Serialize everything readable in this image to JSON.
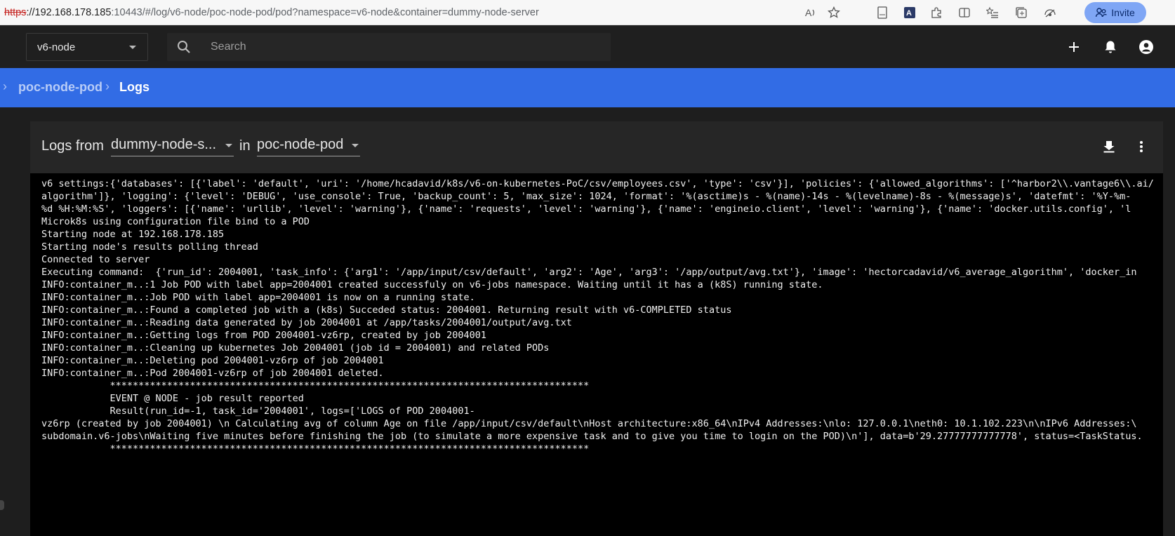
{
  "browser": {
    "url_scheme": "https",
    "url_host": "://192.168.178.185",
    "url_rest": ":10443/#/log/v6-node/poc-node-pod/pod?namespace=v6-node&container=dummy-node-server",
    "invite_label": "Invite"
  },
  "header": {
    "namespace": "v6-node",
    "search_placeholder": "Search"
  },
  "breadcrumb": {
    "parent": "poc-node-pod",
    "current": "Logs"
  },
  "logs": {
    "logs_from_label": "Logs from",
    "container_value": "dummy-node-s...",
    "in_label": "in",
    "pod_value": "poc-node-pod",
    "lines": [
      "v6 settings:{'databases': [{'label': 'default', 'uri': '/home/hcadavid/k8s/v6-on-kubernetes-PoC/csv/employees.csv', 'type': 'csv'}], 'policies': {'allowed_algorithms': ['^harbor2\\\\.vantage6\\\\.ai/",
      "algorithm']}, 'logging': {'level': 'DEBUG', 'use_console': True, 'backup_count': 5, 'max_size': 1024, 'format': '%(asctime)s - %(name)-14s - %(levelname)-8s - %(message)s', 'datefmt': '%Y-%m-",
      "%d %H:%M:%S', 'loggers': [{'name': 'urllib', 'level': 'warning'}, {'name': 'requests', 'level': 'warning'}, {'name': 'engineio.client', 'level': 'warning'}, {'name': 'docker.utils.config', 'l",
      "Microk8s using configuration file bind to a POD",
      "Starting node at 192.168.178.185",
      "Starting node's results polling thread",
      "Connected to server",
      "Executing command:  {'run_id': 2004001, 'task_info': {'arg1': '/app/input/csv/default', 'arg2': 'Age', 'arg3': '/app/output/avg.txt'}, 'image': 'hectorcadavid/v6_average_algorithm', 'docker_in",
      "INFO:container_m..:1 Job POD with label app=2004001 created successfuly on v6-jobs namespace. Waiting until it has a (k8S) running state.",
      "INFO:container_m..:Job POD with label app=2004001 is now on a running state.",
      "INFO:container_m..:Found a completed job with a (k8s) Succeded status: 2004001. Returning result with v6-COMPLETED status",
      "INFO:container_m..:Reading data generated by job 2004001 at /app/tasks/2004001/output/avg.txt",
      "INFO:container_m..:Getting logs from POD 2004001-vz6rp, created by job 2004001",
      "INFO:container_m..:Cleaning up kubernetes Job 2004001 (job id = 2004001) and related PODs",
      "INFO:container_m..:Deleting pod 2004001-vz6rp of job 2004001",
      "INFO:container_m..:Pod 2004001-vz6rp of job 2004001 deleted.",
      "            ************************************************************************************",
      "            EVENT @ NODE - job result reported",
      "            Result(run_id=-1, task_id='2004001', logs=['LOGS of POD 2004001-",
      "vz6rp (created by job 2004001) \\n Calculating avg of column Age on file /app/input/csv/default\\nHost architecture:x86_64\\nIPv4 Addresses:\\nlo: 127.0.0.1\\neth0: 10.1.102.223\\n\\nIPv6 Addresses:\\",
      "subdomain.v6-jobs\\nWaiting five minutes before finishing the job (to simulate a more expensive task and to give you time to login on the POD)\\n'], data=b'29.27777777777778', status=<TaskStatus.",
      "            ************************************************************************************"
    ]
  },
  "colors": {
    "header_bg": "#1f1f1f",
    "breadcrumb_bg": "#326ce5",
    "log_bg": "#000000"
  }
}
